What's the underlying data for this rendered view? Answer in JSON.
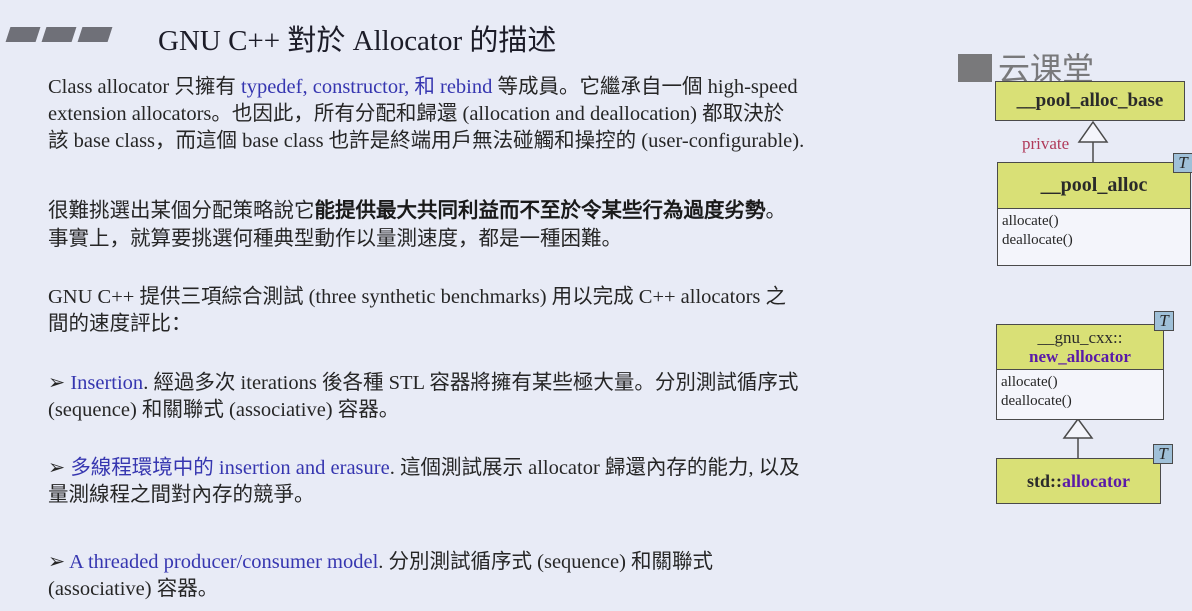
{
  "title": "GNU C++ 對於 Allocator 的描述",
  "watermark": "云课堂",
  "lines": [
    [
      {
        "t": "Class allocator 只擁有 "
      },
      {
        "t": "typedef, constructor, 和 rebind",
        "s": "blue"
      },
      {
        "t": " 等成員。它繼承自一個 high-speed"
      }
    ],
    [
      {
        "t": "extension allocators。也因此，所有分配和歸還 (allocation and deallocation) 都取決於"
      }
    ],
    [
      {
        "t": "該 base class，而這個 base class 也許是終端用戶無法碰觸和操控的 (user-configurable)."
      }
    ],
    [
      {
        "t": "很難挑選出某個分配策略說它"
      },
      {
        "t": "能提供最大共同利益而不至於令某些行為過度劣勢",
        "s": "bold"
      },
      {
        "t": "。"
      }
    ],
    [
      {
        "t": "事實上，就算要挑選何種典型動作以量測速度，都是一種困難。"
      }
    ],
    [
      {
        "t": "GNU C++ 提供三項綜合測試 (three synthetic benchmarks) 用以完成 C++ allocators 之"
      }
    ],
    [
      {
        "t": "間的速度評比："
      }
    ],
    [
      {
        "t": "➢ "
      },
      {
        "t": "Insertion",
        "s": "blue"
      },
      {
        "t": ". 經過多次 iterations 後各種 STL 容器將擁有某些極大量。分別測試循序式"
      }
    ],
    [
      {
        "t": "(sequence) 和關聯式 (associative) 容器。"
      }
    ],
    [
      {
        "t": "➢ "
      },
      {
        "t": "多線程環境中的 insertion and erasure",
        "s": "blue"
      },
      {
        "t": ". 這個測試展示 allocator 歸還內存的能力, 以及"
      }
    ],
    [
      {
        "t": "量測線程之間對內存的競爭。"
      }
    ],
    [
      {
        "t": "➢ "
      },
      {
        "t": "A threaded producer/consumer model",
        "s": "blue"
      },
      {
        "t": ". 分別測試循序式 (sequence) 和關聯式"
      }
    ],
    [
      {
        "t": "(associative) 容器。"
      }
    ]
  ],
  "diagram": {
    "pool_alloc_base": "__pool_alloc_base",
    "private_label": "private",
    "pool_alloc": "__pool_alloc",
    "template_param": "T",
    "allocate": "allocate()",
    "deallocate": "deallocate()",
    "gnu_cxx": "__gnu_cxx::",
    "new_allocator": "new_allocator",
    "std_prefix": "std::",
    "std_allocator": "allocator"
  }
}
